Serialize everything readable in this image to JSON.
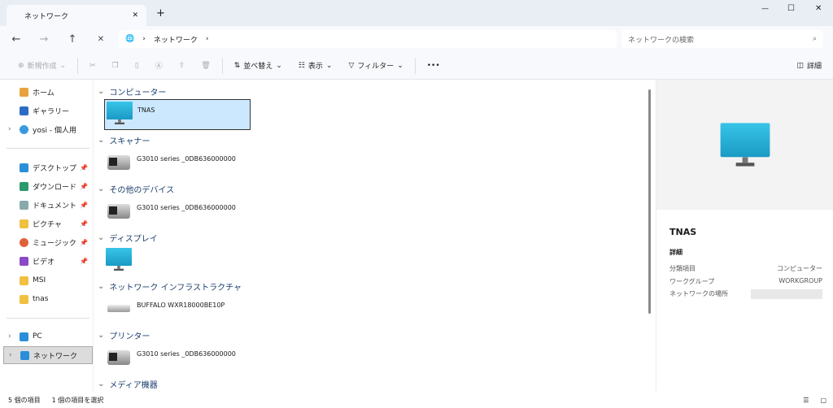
{
  "window": {
    "tab_title": "ネットワーク",
    "new_tab": "+",
    "minimize": "—",
    "maximize": "☐",
    "close": "✕"
  },
  "nav": {
    "back": "←",
    "forward": "→",
    "up": "↑",
    "refresh": "✕",
    "breadcrumb": [
      "ネットワーク"
    ],
    "search_placeholder": "ネットワークの検索"
  },
  "toolbar": {
    "new": "新規作成",
    "sort": "並べ替え",
    "view": "表示",
    "filter": "フィルター",
    "more": "•••",
    "details": "詳細"
  },
  "sidebar": {
    "items": [
      {
        "label": "ホーム",
        "color": "#e8a33d"
      },
      {
        "label": "ギャラリー",
        "color": "#2b6cc4"
      },
      {
        "label": "yosi - 個人用",
        "color": "#3a9ae0"
      },
      {
        "label": "デスクトップ",
        "color": "#2a8fd8"
      },
      {
        "label": "ダウンロード",
        "color": "#2a9a6a"
      },
      {
        "label": "ドキュメント",
        "color": "#8aa"
      },
      {
        "label": "ピクチャ",
        "color": "#f0c040"
      },
      {
        "label": "ミュージック",
        "color": "#e0603a"
      },
      {
        "label": "ビデオ",
        "color": "#8a4ac8"
      },
      {
        "label": "MSI",
        "color": "#f0c040"
      },
      {
        "label": "tnas",
        "color": "#f0c040"
      },
      {
        "label": "PC",
        "color": "#2a8fd8"
      },
      {
        "label": "ネットワーク",
        "color": "#2a8fd8"
      }
    ]
  },
  "groups": [
    {
      "name": "コンピューター",
      "item": "TNAS"
    },
    {
      "name": "スキャナー",
      "item": "G3010 series _0DB636000000"
    },
    {
      "name": "その他のデバイス",
      "item": "G3010 series _0DB636000000"
    },
    {
      "name": "ディスプレイ",
      "item": ""
    },
    {
      "name": "ネットワーク インフラストラクチャ",
      "item": "BUFFALO WXR18000BE10P"
    },
    {
      "name": "プリンター",
      "item": "G3010 series _0DB636000000"
    },
    {
      "name": "メディア機器",
      "item": ""
    }
  ],
  "details": {
    "title": "TNAS",
    "section": "詳細",
    "rows": [
      {
        "k": "分類項目",
        "v": "コンピューター"
      },
      {
        "k": "ワークグループ",
        "v": "WORKGROUP"
      },
      {
        "k": "ネットワークの場所",
        "v": ""
      }
    ]
  },
  "status": {
    "count": "5 個の項目",
    "selected": "1 個の項目を選択"
  }
}
